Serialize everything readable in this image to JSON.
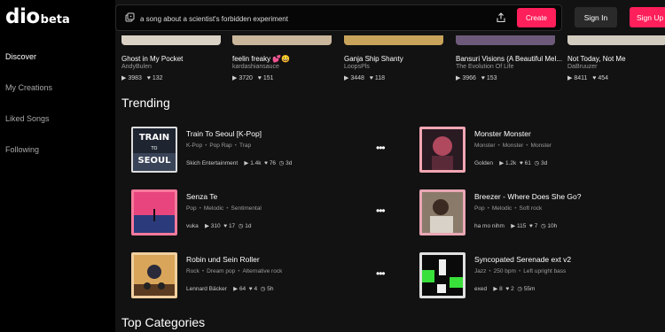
{
  "logo": {
    "main": "dio",
    "beta": "beta"
  },
  "nav": {
    "discover": "Discover",
    "my_creations": "My Creations",
    "liked_songs": "Liked Songs",
    "following": "Following"
  },
  "search": {
    "value": "a song about a scientist's forbidden experiment"
  },
  "buttons": {
    "create": "Create",
    "sign_in": "Sign In",
    "sign_up": "Sign Up"
  },
  "top_cards": [
    {
      "title": "Ghost in My Pocket",
      "artist": "AndyBulen",
      "plays": "3983",
      "likes": "132"
    },
    {
      "title": "feelin freaky 💕😀",
      "artist": "kardashiansauce",
      "plays": "3720",
      "likes": "151"
    },
    {
      "title": "Ganja Ship Shanty",
      "artist": "LoopsPls",
      "plays": "3448",
      "likes": "118"
    },
    {
      "title": "Bansuri Visions (A Beautiful Mel...",
      "artist": "The Evolution Of Life",
      "plays": "3966",
      "likes": "153"
    },
    {
      "title": "Not Today, Not Me",
      "artist": "DaBruuzer",
      "plays": "8411",
      "likes": "454"
    }
  ],
  "trending_title": "Trending",
  "categories_title": "Top Categories",
  "trending": [
    {
      "name": "Train To Seoul [K-Pop]",
      "tags": [
        "K-Pop",
        "Pop Rap",
        "Trap"
      ],
      "artist": "Skich Entertainment",
      "plays": "1.4k",
      "likes": "76",
      "age": "3d",
      "art_text": [
        "TRAIN",
        "TO",
        "SEOUL"
      ]
    },
    {
      "name": "Monster Monster",
      "tags": [
        "Monster",
        "Monster",
        "Monster"
      ],
      "artist": "Golden",
      "plays": "1.2k",
      "likes": "61",
      "age": "3d"
    },
    {
      "name": "Senza Te",
      "tags": [
        "Pop",
        "Melodic",
        "Sentimental"
      ],
      "artist": "vuka",
      "plays": "310",
      "likes": "17",
      "age": "1d"
    },
    {
      "name": "Breezer - Where Does She Go?",
      "tags": [
        "Pop",
        "Melodic",
        "Soft rock"
      ],
      "artist": "ha mo nihm",
      "plays": "115",
      "likes": "7",
      "age": "10h"
    },
    {
      "name": "Robin und Sein Roller",
      "tags": [
        "Rock",
        "Dream pop",
        "Alternative rock"
      ],
      "artist": "Lennard Bäcker",
      "plays": "64",
      "likes": "4",
      "age": "5h"
    },
    {
      "name": "Syncopated Serenade ext v2",
      "tags": [
        "Jazz",
        "250 bpm",
        "Left upright bass"
      ],
      "artist": "exed",
      "plays": "8",
      "likes": "2",
      "age": "55m"
    }
  ],
  "icons": {
    "dice": "dice-icon",
    "share": "share-icon",
    "play": "play-icon",
    "heart": "heart-icon",
    "clock": "clock-icon",
    "more": "more-dots-icon"
  },
  "colors": {
    "accent": "#ff1f5a",
    "background": "#121212",
    "sidebar": "#000000"
  }
}
